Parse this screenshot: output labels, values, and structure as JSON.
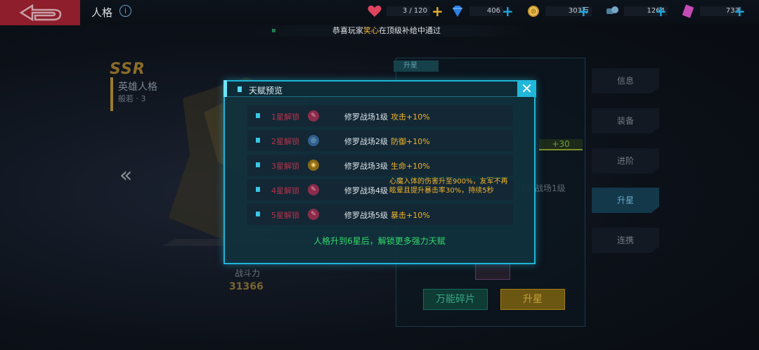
{
  "header": {
    "page_title": "人格",
    "info_glyph": "i",
    "resources": [
      {
        "name": "stamina",
        "icon": "heart-icon",
        "value": "3 / 120",
        "plus": "+"
      },
      {
        "name": "diamond",
        "icon": "diamond-icon",
        "value": "406",
        "plus": "+"
      },
      {
        "name": "coin",
        "icon": "coin-icon",
        "value": "303万",
        "plus": "+"
      },
      {
        "name": "material",
        "icon": "gear-material-icon",
        "value": "1264",
        "plus": "+"
      },
      {
        "name": "ticket",
        "icon": "ticket-icon",
        "value": "733",
        "plus": "+"
      }
    ]
  },
  "marquee": {
    "prefix": "恭喜玩家",
    "player": "笑心",
    "suffix": "在顶级补给中通过"
  },
  "hero": {
    "rarity": "SSR",
    "title": "英雄人格",
    "subtitle": "般若 · 3",
    "power_label": "战斗力",
    "power_value": "31366",
    "nav_left": "«"
  },
  "right_panel": {
    "tab_label": "升星",
    "level_badge": "+30",
    "partial_text": "修罗战场1级",
    "fragment_button": "万能碎片",
    "upgrade_button": "升星"
  },
  "side_tabs": [
    "信息",
    "装备",
    "进阶",
    "升星",
    "连携"
  ],
  "side_tab_active": "升星",
  "dialog": {
    "title": "天赋预览",
    "close_glyph": "✕",
    "footer": "人格升到6星后，解锁更多强力天赋",
    "rows": [
      {
        "unlock": "1星解锁",
        "talent": "修罗战场1级",
        "effect": "攻击+10%",
        "icon_glyph": "✎",
        "icon_color": "#8a2c4a"
      },
      {
        "unlock": "2星解锁",
        "talent": "修罗战场2级",
        "effect": "防御+10%",
        "icon_glyph": "◎",
        "icon_color": "#2f5f8a"
      },
      {
        "unlock": "3星解锁",
        "talent": "修罗战场3级",
        "effect": "生命+10%",
        "icon_glyph": "◉",
        "icon_color": "#8a6a14"
      },
      {
        "unlock": "4星解锁",
        "talent": "修罗战场4级",
        "effect": "心魔入体的伤害升至900%，友军不再眩晕且提升暴击率30%，持续5秒",
        "icon_glyph": "✎",
        "icon_color": "#8a2c4a"
      },
      {
        "unlock": "5星解锁",
        "talent": "修罗战场5级",
        "effect": "暴击+10%",
        "icon_glyph": "✎",
        "icon_color": "#8a2c4a"
      }
    ]
  },
  "colors": {
    "accent": "#1fb5d8",
    "unlock_text": "#b5334b",
    "effect_text": "#f0b42c",
    "footer_text": "#36d86a",
    "back_button": "#8e1e2b"
  }
}
